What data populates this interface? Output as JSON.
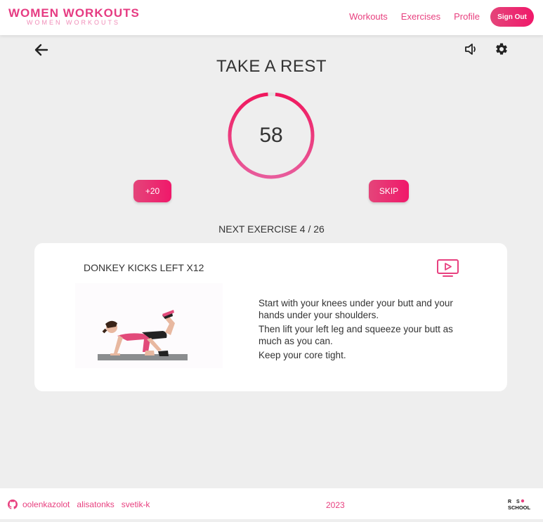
{
  "header": {
    "logo_title": "WOMEN WORKOUTS",
    "logo_subtitle": "WOMEN WORKOUTS",
    "nav": [
      "Workouts",
      "Exercises",
      "Profile"
    ],
    "sign_out": "Sign Out"
  },
  "rest": {
    "title": "TAKE A REST",
    "seconds": "58",
    "add_label": "+20",
    "skip_label": "SKIP"
  },
  "next": {
    "label": "NEXT EXERCISE 4 / 26",
    "exercise_name": "DONKEY KICKS LEFT X12",
    "description": [
      "Start with your knees under your butt and your hands under your shoulders.",
      "Then lift your left leg and squeeze your butt as much as you can.",
      "Keep your core tight."
    ]
  },
  "footer": {
    "authors": [
      "oolenkazolot",
      "alisatonks",
      "svetik-k"
    ],
    "year": "2023",
    "school_logo": "RS SCHOOL"
  },
  "colors": {
    "accent": "#e8407f",
    "accent_gradient_start": "#e4457a",
    "accent_gradient_end": "#f0186a",
    "background": "#eeeeee"
  },
  "icons": {
    "back": "arrow-left-icon",
    "sound": "volume-icon",
    "settings": "gear-icon",
    "video": "video-play-icon",
    "github": "github-icon"
  }
}
